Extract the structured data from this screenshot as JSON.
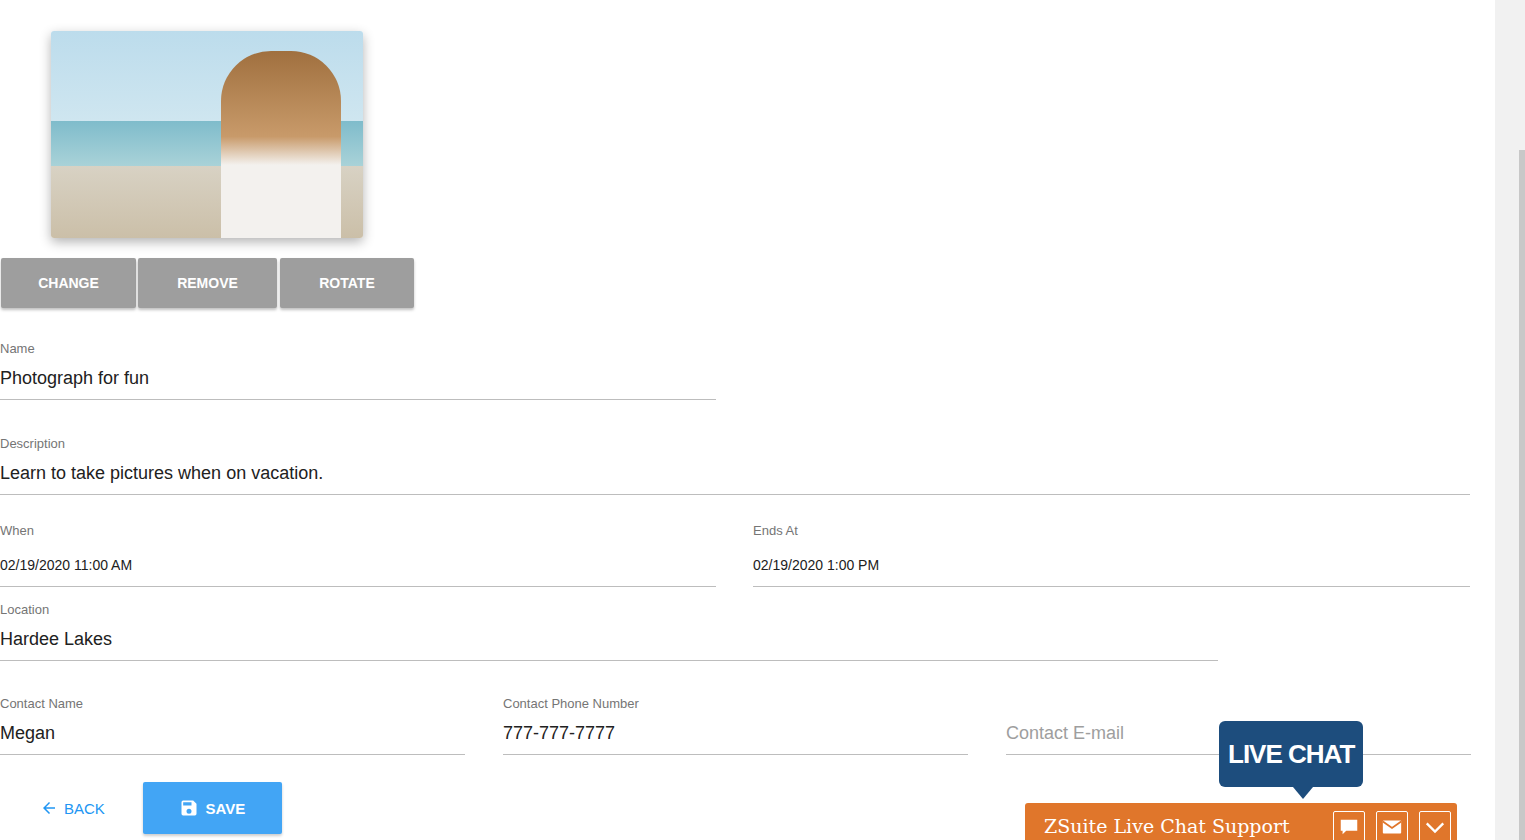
{
  "image_buttons": [
    "CHANGE",
    "REMOVE",
    "ROTATE"
  ],
  "rows": [
    [
      {
        "label": "Name",
        "value": "Photograph for fun",
        "kind": "text"
      }
    ],
    [
      {
        "label": "Description",
        "value": "Learn to take pictures when on vacation.",
        "kind": "text"
      }
    ],
    [
      {
        "label": "When",
        "value": "02/19/2020 11:00 AM",
        "kind": "date"
      },
      {
        "label": "Ends At",
        "value": "02/19/2020 1:00 PM",
        "kind": "date"
      }
    ],
    [
      {
        "label": "Location",
        "value": "Hardee Lakes",
        "kind": "text"
      }
    ],
    [
      {
        "label": "Contact Name",
        "value": "Megan",
        "kind": "text"
      },
      {
        "label": "Contact Phone Number",
        "value": "777-777-7777",
        "kind": "text"
      },
      {
        "label": "",
        "placeholder": "Contact E-mail",
        "value": "",
        "kind": "empty"
      }
    ]
  ],
  "actions": {
    "back": "BACK",
    "save": "SAVE"
  },
  "chat": {
    "badge": "LIVE CHAT",
    "title": "ZSuite Live Chat Support"
  }
}
